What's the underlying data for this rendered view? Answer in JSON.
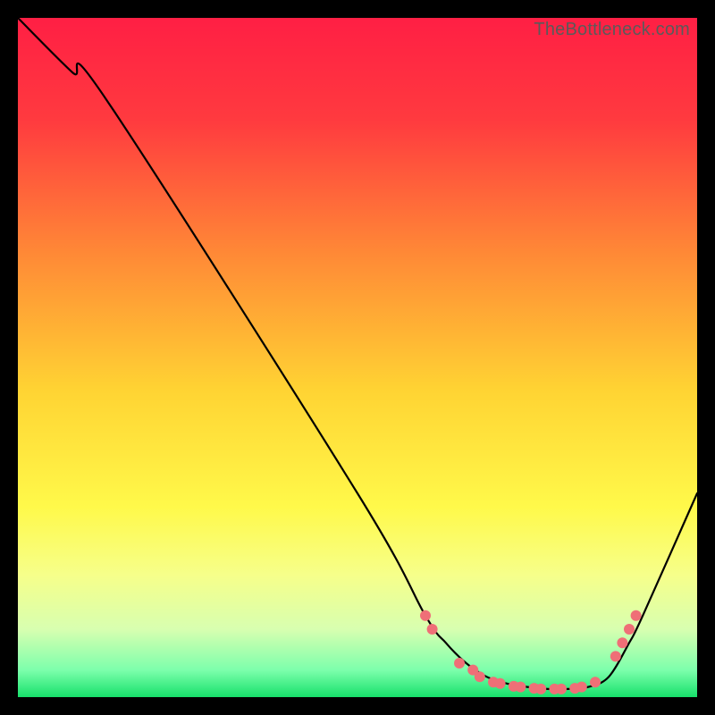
{
  "watermark": "TheBottleneck.com",
  "chart_data": {
    "type": "line",
    "title": "",
    "xlabel": "",
    "ylabel": "",
    "xlim": [
      0,
      100
    ],
    "ylim": [
      0,
      100
    ],
    "grid": false,
    "legend": false,
    "gradient_stops": [
      {
        "offset": 0.0,
        "color": "#ff1f44"
      },
      {
        "offset": 0.15,
        "color": "#ff3a3f"
      },
      {
        "offset": 0.35,
        "color": "#ff8a36"
      },
      {
        "offset": 0.55,
        "color": "#ffd433"
      },
      {
        "offset": 0.72,
        "color": "#fff94a"
      },
      {
        "offset": 0.82,
        "color": "#f6ff8a"
      },
      {
        "offset": 0.9,
        "color": "#d8ffb0"
      },
      {
        "offset": 0.96,
        "color": "#7dffac"
      },
      {
        "offset": 1.0,
        "color": "#17e06b"
      }
    ],
    "curve": {
      "x": [
        0,
        8,
        13,
        50,
        60,
        63,
        66,
        69,
        72,
        75,
        78,
        81,
        84,
        87,
        90,
        92,
        100
      ],
      "y": [
        100,
        92,
        88,
        30,
        12,
        8,
        5,
        3,
        2,
        1.5,
        1.2,
        1.2,
        1.5,
        3,
        8,
        12,
        30
      ]
    },
    "markers": {
      "x": [
        60,
        61,
        65,
        67,
        68,
        70,
        71,
        73,
        74,
        76,
        77,
        79,
        80,
        82,
        83,
        85,
        88,
        89,
        90,
        91
      ],
      "y": [
        12,
        10,
        5,
        4,
        3,
        2.2,
        2.0,
        1.6,
        1.5,
        1.3,
        1.2,
        1.2,
        1.2,
        1.3,
        1.5,
        2.2,
        6,
        8,
        10,
        12
      ],
      "color": "#ef6f77",
      "radius": 6
    }
  }
}
